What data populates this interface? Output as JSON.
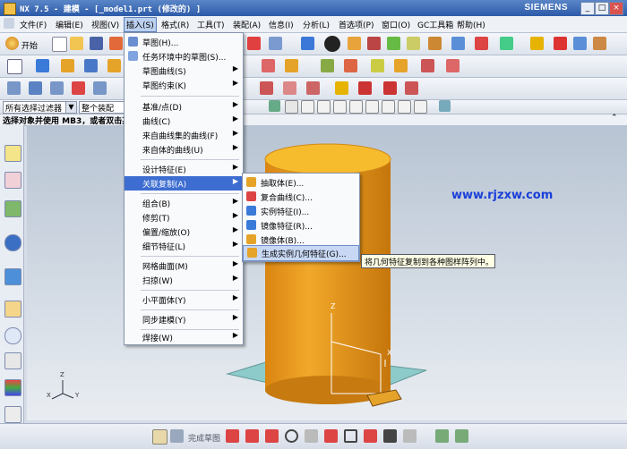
{
  "window": {
    "title": "NX 7.5 - 建模 - [_model1.prt  (修改的) ]",
    "brand": "SIEMENS",
    "controls": [
      "_",
      "□",
      "×"
    ]
  },
  "menubar": [
    "文件(F)",
    "编辑(E)",
    "视图(V)",
    "插入(S)",
    "格式(R)",
    "工具(T)",
    "装配(A)",
    "信息(I)",
    "分析(L)",
    "首选项(P)",
    "窗口(O)",
    "GC工具箱",
    "帮助(H)"
  ],
  "toolbar": {
    "start_label": "开始",
    "filter_value": "所有选择过滤器",
    "assembly_value": "整个装配",
    "status_prompt": "选择对象并使用 MB3，或者双击某"
  },
  "insert_menu": {
    "items": [
      {
        "label": "草图(H)...",
        "submenu": false
      },
      {
        "label": "任务环境中的草图(S)...",
        "submenu": false
      },
      {
        "label": "草图曲线(S)",
        "submenu": true
      },
      {
        "label": "草图约束(K)",
        "submenu": true
      },
      {
        "label": "基准/点(D)",
        "submenu": true
      },
      {
        "label": "曲线(C)",
        "submenu": true
      },
      {
        "label": "来自曲线集的曲线(F)",
        "submenu": true
      },
      {
        "label": "来自体的曲线(U)",
        "submenu": true
      },
      {
        "label": "设计特征(E)",
        "submenu": true
      },
      {
        "label": "关联复制(A)",
        "submenu": true,
        "highlighted": true
      },
      {
        "label": "组合(B)",
        "submenu": true
      },
      {
        "label": "修剪(T)",
        "submenu": true
      },
      {
        "label": "偏置/缩放(O)",
        "submenu": true
      },
      {
        "label": "细节特征(L)",
        "submenu": true
      },
      {
        "label": "网格曲面(M)",
        "submenu": true
      },
      {
        "label": "扫掠(W)",
        "submenu": true
      },
      {
        "label": "小平面体(Y)",
        "submenu": true
      },
      {
        "label": "同步建模(Y)",
        "submenu": true
      },
      {
        "label": "焊接(W)",
        "submenu": true
      }
    ]
  },
  "associative_copy_menu": {
    "items": [
      {
        "label": "抽取体(E)..."
      },
      {
        "label": "复合曲线(C)..."
      },
      {
        "label": "实例特征(I)..."
      },
      {
        "label": "镜像特征(R)..."
      },
      {
        "label": "镜像体(B)..."
      },
      {
        "label": "生成实例几何特征(G)...",
        "highlighted": true
      }
    ]
  },
  "tooltip": "将几何特征复制到各种图样阵列中。",
  "watermark": "www.rjzxw.com",
  "bottom_toolbar": {
    "finish_sketch_label": "完成草图"
  },
  "axis_labels": {
    "z": "Z",
    "x": "X",
    "y": "Y"
  },
  "colors": {
    "cylinder": "#f0a020",
    "datum_plane": "#7fc6c4",
    "menu_highlight": "#3d6dd1",
    "watermark": "#1a3fd8"
  }
}
